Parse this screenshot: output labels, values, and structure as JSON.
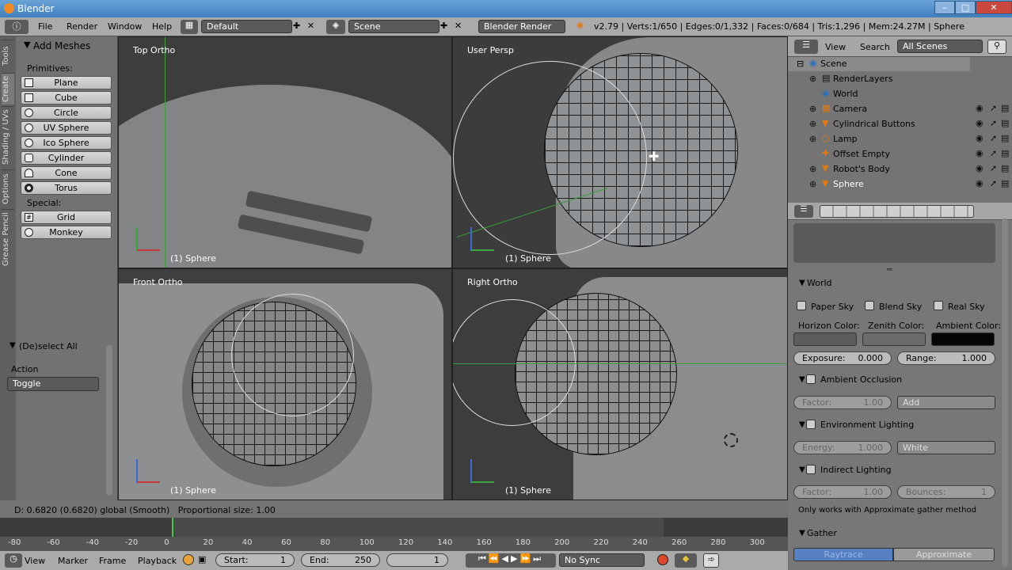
{
  "window": {
    "title": "Blender"
  },
  "menubar": {
    "items": [
      "File",
      "Render",
      "Window",
      "Help"
    ],
    "layout": "Default",
    "scene": "Scene",
    "engine": "Blender Render",
    "stats": "v2.79 | Verts:1/650 | Edges:0/1,332 | Faces:0/684 | Tris:1,296 | Mem:24.27M | Sphere"
  },
  "toolshelf": {
    "tabs": [
      "Tools",
      "Create",
      "Shading / UVs",
      "Options",
      "Grease Pencil"
    ],
    "panel_title": "Add Meshes",
    "primitives_label": "Primitives:",
    "primitives": [
      "Plane",
      "Cube",
      "Circle",
      "UV Sphere",
      "Ico Sphere",
      "Cylinder",
      "Cone",
      "Torus"
    ],
    "special_label": "Special:",
    "special": [
      "Grid",
      "Monkey"
    ],
    "operator_title": "(De)select All",
    "action_label": "Action",
    "action_value": "Toggle"
  },
  "viewports": {
    "top": "Top Ortho",
    "user": "User Persp",
    "front": "Front Ortho",
    "right": "Right Ortho",
    "object": "(1) Sphere"
  },
  "outliner": {
    "view": "View",
    "search": "Search",
    "filter": "All Scenes",
    "items": [
      "Scene",
      "RenderLayers",
      "World",
      "Camera",
      "Cylindrical Buttons",
      "Lamp",
      "Offset Empty",
      "Robot's Body",
      "Sphere"
    ]
  },
  "properties": {
    "world_title": "World",
    "paper_sky": "Paper Sky",
    "blend_sky": "Blend Sky",
    "real_sky": "Real Sky",
    "horizon_color": "Horizon Color:",
    "zenith_color": "Zenith Color:",
    "ambient_color": "Ambient Color:",
    "exposure_label": "Exposure:",
    "exposure_value": "0.000",
    "range_label": "Range:",
    "range_value": "1.000",
    "ao_title": "Ambient Occlusion",
    "factor_label": "Factor:",
    "ao_factor": "1.00",
    "ao_blend": "Add",
    "env_title": "Environment Lighting",
    "energy_label": "Energy:",
    "env_energy": "1.000",
    "env_color": "White",
    "indirect_title": "Indirect Lighting",
    "ind_factor": "1.00",
    "bounces_label": "Bounces:",
    "bounces_value": "1",
    "indirect_note": "Only works with Approximate gather method",
    "gather_title": "Gather",
    "raytrace": "Raytrace",
    "approximate": "Approximate",
    "colors": {
      "horizon": "#5d5d5d",
      "zenith": "#6a6a6a",
      "ambient": "#050505"
    }
  },
  "status": {
    "text": "D: 0.6820 (0.6820) global (Smooth)   Proportional size: 1.00"
  },
  "timeline": {
    "ticks": [
      "-80",
      "-60",
      "-40",
      "-20",
      "0",
      "20",
      "40",
      "60",
      "80",
      "100",
      "120",
      "140",
      "160",
      "180",
      "200",
      "220",
      "240",
      "260",
      "280",
      "300"
    ],
    "menu": [
      "View",
      "Marker",
      "Frame",
      "Playback"
    ],
    "start_label": "Start:",
    "start": "1",
    "end_label": "End:",
    "end": "250",
    "current": "1",
    "sync": "No Sync"
  }
}
